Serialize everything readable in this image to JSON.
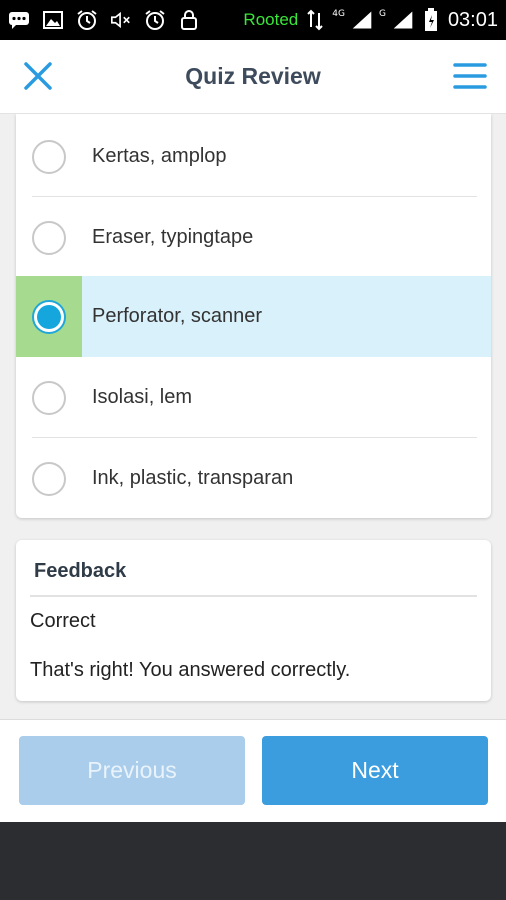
{
  "status_bar": {
    "rooted": "Rooted",
    "network_4g": "4G",
    "network_g": "G",
    "time": "03:01",
    "icons": [
      "chat-icon",
      "image-icon",
      "alarm-icon",
      "mute-icon",
      "alarm-icon",
      "lock-icon",
      "data-arrows-icon",
      "signal-icon",
      "battery-icon"
    ]
  },
  "app_bar": {
    "title": "Quiz Review",
    "close_icon": "close-icon",
    "menu_icon": "menu-icon",
    "accent": "#2a9be0"
  },
  "options": [
    {
      "label": "Kertas, amplop",
      "selected": false
    },
    {
      "label": "Eraser, typingtape",
      "selected": false
    },
    {
      "label": "Perforator, scanner",
      "selected": true
    },
    {
      "label": "Isolasi, lem",
      "selected": false
    },
    {
      "label": "Ink, plastic, transparan",
      "selected": false
    }
  ],
  "feedback": {
    "title": "Feedback",
    "status": "Correct",
    "message": "That's right! You answered correctly."
  },
  "nav": {
    "previous_label": "Previous",
    "next_label": "Next"
  }
}
